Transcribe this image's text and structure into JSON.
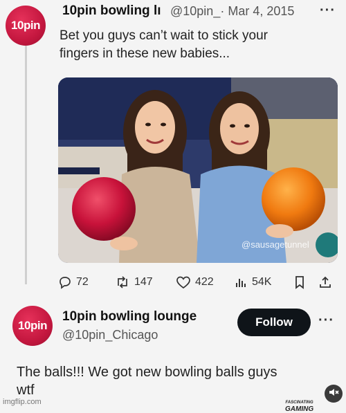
{
  "tweet": {
    "avatar_text": "10pin",
    "display_name": "10pin bowling lı",
    "handle_date": "@10pin_· Mar 4, 2015",
    "more": "···",
    "text_line1": "Bet you guys can’t wait to stick your",
    "text_line2": "fingers in these new babies...",
    "watermark": "@sausagetunnel",
    "stats": {
      "replies": "72",
      "retweets": "147",
      "likes": "422",
      "views": "54K"
    }
  },
  "reply": {
    "avatar_text": "10pin",
    "display_name": "10pin bowling lounge",
    "handle": "@10pin_Chicago",
    "follow_label": "Follow",
    "more": "···",
    "text_line1": "The balls!!! We got new bowling balls guys",
    "text_line2": "wtf"
  },
  "footer": {
    "imgflip": "imgflip.com",
    "brand_top": "FASCINATING",
    "brand_bottom": "GAMING"
  },
  "icons": [
    "reply-icon",
    "retweet-icon",
    "like-icon",
    "views-icon",
    "bookmark-icon",
    "share-icon",
    "mute-icon"
  ],
  "colors": {
    "avatar": "#c4173f",
    "follow_bg": "#0f1419"
  }
}
